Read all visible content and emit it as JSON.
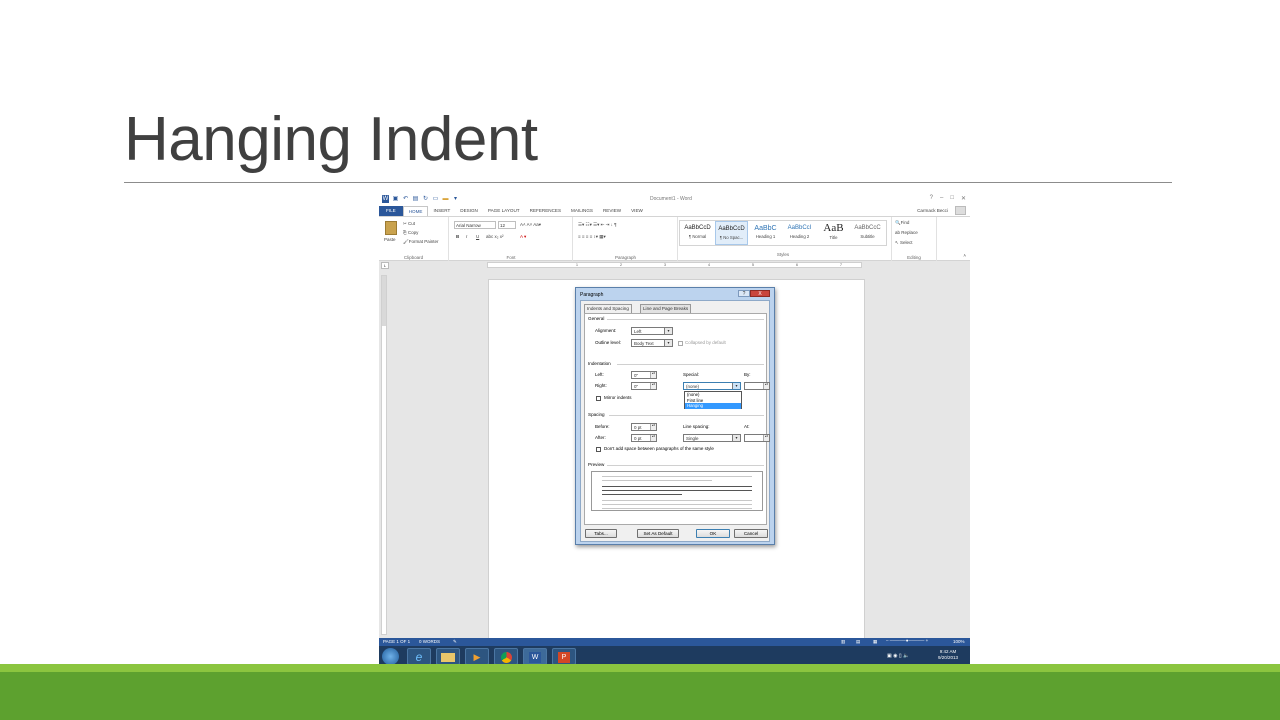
{
  "slide": {
    "title": "Hanging Indent"
  },
  "word": {
    "window_title": "Document1 - Word",
    "user": "Carmack Becci",
    "tabs": [
      "FILE",
      "HOME",
      "INSERT",
      "DESIGN",
      "PAGE LAYOUT",
      "REFERENCES",
      "MAILINGS",
      "REVIEW",
      "VIEW"
    ],
    "active_tab": "HOME",
    "clipboard": {
      "paste": "Paste",
      "cut": "Cut",
      "copy": "Copy",
      "format_painter": "Format Painter",
      "label": "Clipboard"
    },
    "font": {
      "name": "Arial Narrow",
      "size": "12",
      "label": "Font",
      "bold": "B",
      "italic": "I",
      "underline": "U"
    },
    "paragraph_label": "Paragraph",
    "styles": {
      "label": "Styles",
      "items": [
        {
          "sample": "AaBbCcD",
          "name": "¶ Normal"
        },
        {
          "sample": "AaBbCcD",
          "name": "¶ No Spac..."
        },
        {
          "sample": "AaBbC",
          "name": "Heading 1"
        },
        {
          "sample": "AaBbCcI",
          "name": "Heading 2"
        },
        {
          "sample": "AaB",
          "name": "Title"
        },
        {
          "sample": "AaBbCcC",
          "name": "Subtitle"
        }
      ]
    },
    "editing": {
      "find": "Find",
      "replace": "Replace",
      "select": "Select",
      "label": "Editing"
    },
    "ruler_numbers": [
      "1",
      "2",
      "3",
      "4",
      "5",
      "6",
      "7"
    ],
    "status": {
      "page": "PAGE 1 OF 1",
      "words": "0 WORDS",
      "zoom": "100%"
    },
    "taskbar": {
      "time": "9:42 AM",
      "date": "9/20/2013"
    }
  },
  "dialog": {
    "title": "Paragraph",
    "help": "?",
    "close": "X",
    "tabs": [
      "Indents and Spacing",
      "Line and Page Breaks"
    ],
    "general": {
      "heading": "General",
      "alignment_label": "Alignment:",
      "alignment_value": "Left",
      "outline_label": "Outline level:",
      "outline_value": "Body Text",
      "collapsed_label": "Collapsed by default"
    },
    "indentation": {
      "heading": "Indentation",
      "left_label": "Left:",
      "left_value": "0\"",
      "right_label": "Right:",
      "right_value": "0\"",
      "special_label": "Special:",
      "special_value": "(none)",
      "by_label": "By:",
      "mirror_label": "Mirror indents",
      "special_options": [
        "(none)",
        "First line",
        "Hanging"
      ],
      "special_highlighted": "Hanging"
    },
    "spacing": {
      "heading": "Spacing",
      "before_label": "Before:",
      "before_value": "0 pt",
      "after_label": "After:",
      "after_value": "0 pt",
      "line_label": "Line spacing:",
      "line_value": "Single",
      "at_label": "At:",
      "dont_add_label": "Don't add space between paragraphs of the same style"
    },
    "preview_heading": "Preview",
    "buttons": {
      "tabs": "Tabs...",
      "set_default": "Set As Default",
      "ok": "OK",
      "cancel": "Cancel"
    }
  }
}
